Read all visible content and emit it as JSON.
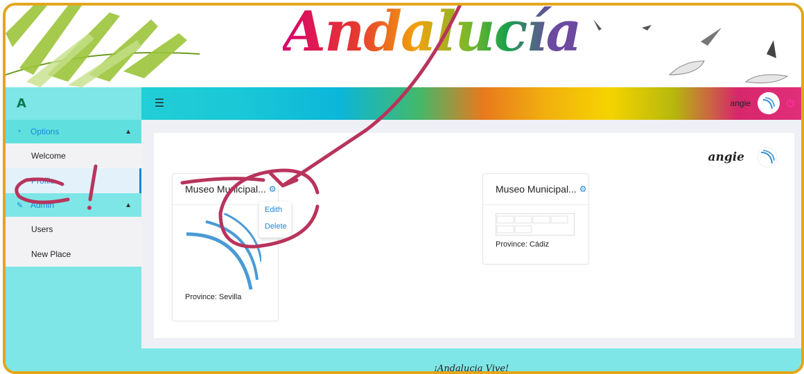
{
  "banner": {
    "logo": "Andalucía"
  },
  "header": {
    "brand": "A",
    "user": "angie"
  },
  "sidebar": {
    "groups": [
      {
        "label": "Options",
        "items": [
          "Welcome",
          "Profile"
        ]
      },
      {
        "label": "Admin",
        "items": [
          "Users",
          "New Place"
        ]
      }
    ]
  },
  "panel": {
    "user": "angie"
  },
  "cards": [
    {
      "title": "Museo Municipal...",
      "province": "Province: Sevilla"
    },
    {
      "title": "Museo Municipal...",
      "province": "Province: Cádiz"
    }
  ],
  "dropdown": {
    "edit": "Edith",
    "delete": "Delete"
  },
  "footer": {
    "text": "¡Andalucia Vive!"
  },
  "colors": {
    "accent": "#1a86d8",
    "frame": "#e2a61c",
    "sidebar": "#7ee6e6"
  }
}
